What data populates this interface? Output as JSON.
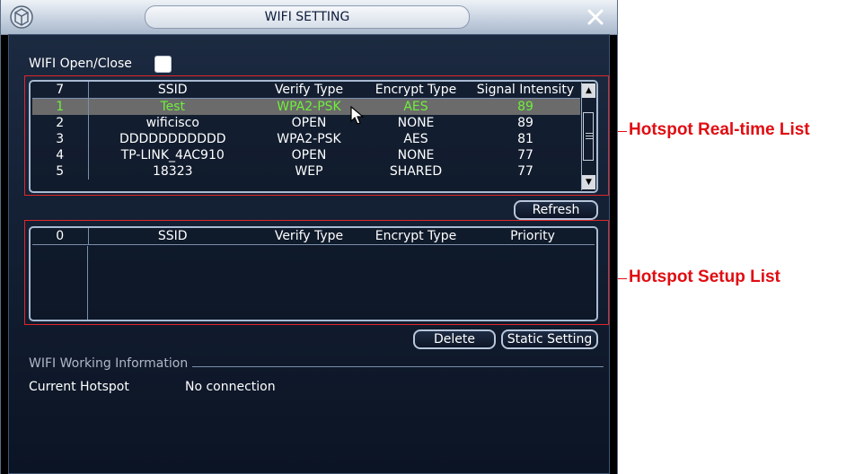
{
  "window": {
    "title": "WIFI SETTING"
  },
  "wifi_toggle": {
    "label": "WIFI Open/Close",
    "checked": false
  },
  "realtime_list": {
    "headers": [
      "7",
      "SSID",
      "Verify Type",
      "Encrypt Type",
      "Signal Intensity"
    ],
    "rows": [
      [
        "1",
        "Test",
        "WPA2-PSK",
        "AES",
        "89"
      ],
      [
        "2",
        "wificisco",
        "OPEN",
        "NONE",
        "89"
      ],
      [
        "3",
        "DDDDDDDDDDD",
        "WPA2-PSK",
        "AES",
        "81"
      ],
      [
        "4",
        "TP-LINK_4AC910",
        "OPEN",
        "NONE",
        "77"
      ],
      [
        "5",
        "18323",
        "WEP",
        "SHARED",
        "77"
      ]
    ],
    "selected_row": 0
  },
  "buttons": {
    "refresh": "Refresh",
    "delete": "Delete",
    "static_setting": "Static Setting"
  },
  "setup_list": {
    "headers": [
      "0",
      "SSID",
      "Verify Type",
      "Encrypt Type",
      "Priority"
    ]
  },
  "working_info": {
    "title": "WIFI Working Information",
    "current_hotspot_label": "Current Hotspot",
    "current_hotspot_value": "No connection"
  },
  "annotations": {
    "realtime": "Hotspot Real-time List",
    "setup": "Hotspot Setup List"
  },
  "colors": {
    "selected_text": "#6ef03a",
    "annotation": "#e00d12",
    "panel_bg": "#142034"
  }
}
